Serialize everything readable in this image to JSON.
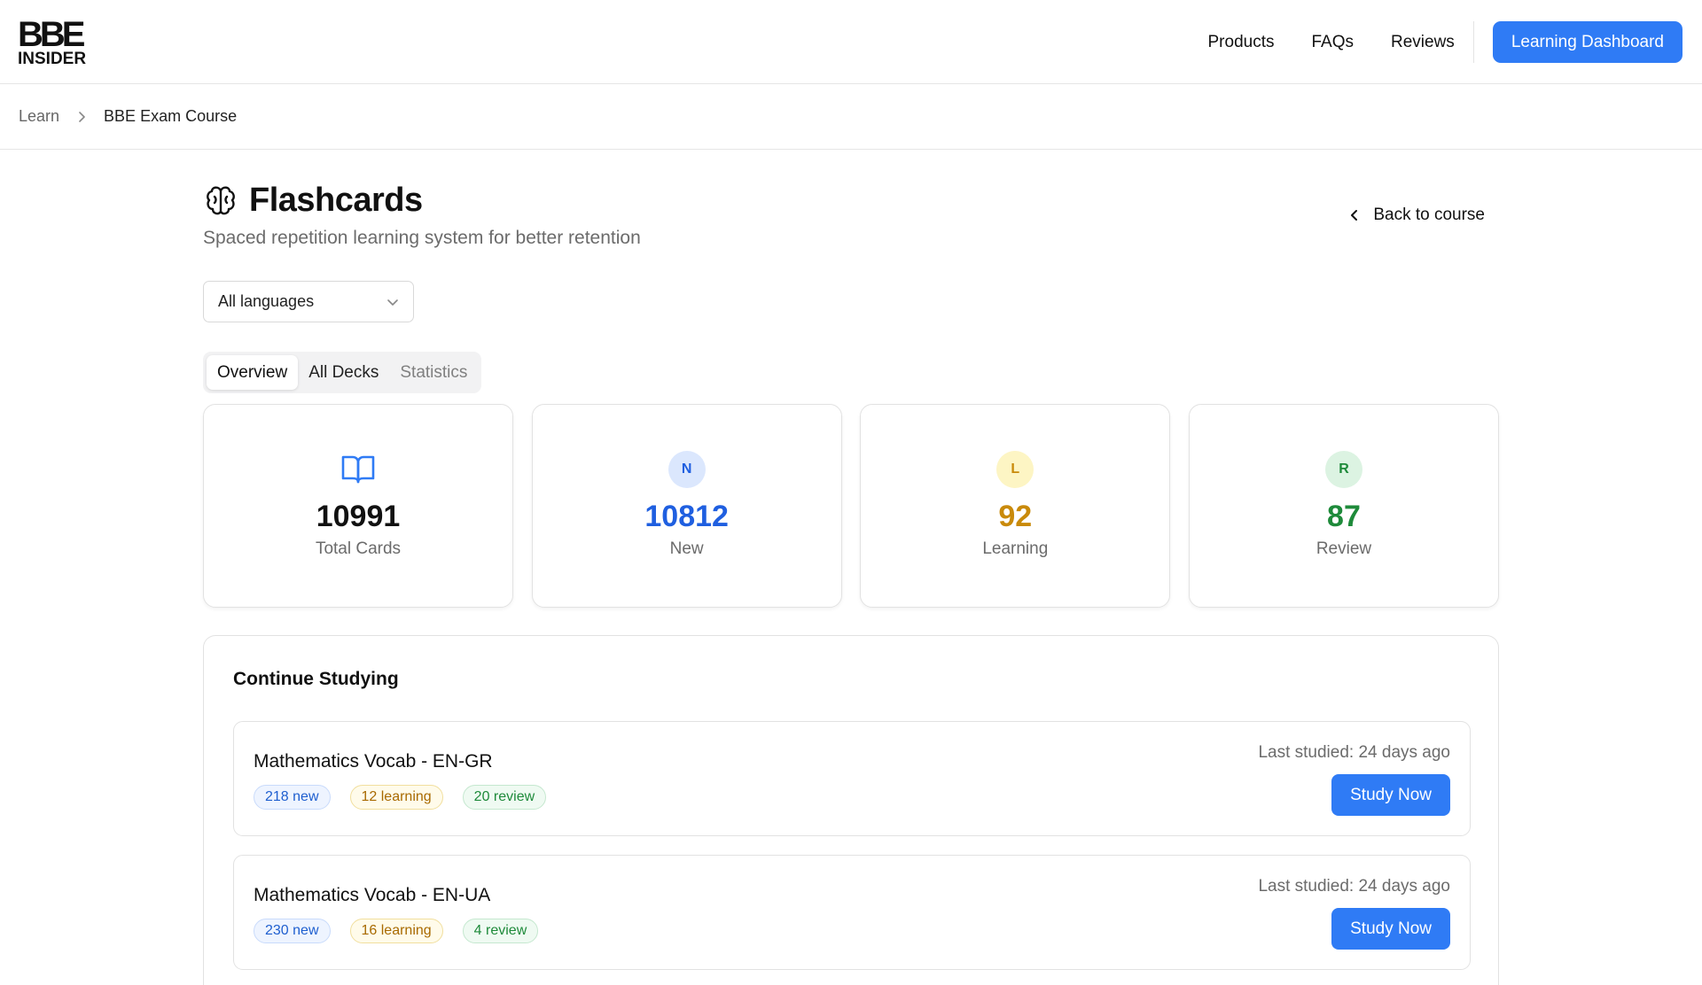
{
  "header": {
    "logo_mark": "BBE",
    "logo_sub": "INSIDER",
    "nav": [
      "Products",
      "FAQs",
      "Reviews"
    ],
    "cta_label": "Learning Dashboard"
  },
  "breadcrumb": {
    "items": [
      "Learn",
      "BBE Exam Course"
    ]
  },
  "page": {
    "title": "Flashcards",
    "subtitle": "Spaced repetition learning system for better retention",
    "back_label": "Back to course",
    "language_select": "All languages"
  },
  "tabs": [
    {
      "label": "Overview",
      "state": "active"
    },
    {
      "label": "All Decks",
      "state": "normal"
    },
    {
      "label": "Statistics",
      "state": "muted"
    }
  ],
  "stats": [
    {
      "badge": "",
      "icon": "book-open-icon",
      "value": "10991",
      "label": "Total Cards",
      "color": "#111111"
    },
    {
      "badge": "N",
      "value": "10812",
      "label": "New",
      "color": "#1f5fe0",
      "badge_bg": "#dbe7fd"
    },
    {
      "badge": "L",
      "value": "92",
      "label": "Learning",
      "color": "#c98a0a",
      "badge_bg": "#fdf5c4"
    },
    {
      "badge": "R",
      "value": "87",
      "label": "Review",
      "color": "#1e8a3a",
      "badge_bg": "#dcf3e2"
    }
  ],
  "continue": {
    "title": "Continue Studying",
    "decks": [
      {
        "name": "Mathematics Vocab - EN-GR",
        "new": "218 new",
        "learning": "12 learning",
        "review": "20 review",
        "last": "Last studied: 24 days ago",
        "action": "Study Now"
      },
      {
        "name": "Mathematics Vocab - EN-UA",
        "new": "230 new",
        "learning": "16 learning",
        "review": "4 review",
        "last": "Last studied: 24 days ago",
        "action": "Study Now"
      }
    ]
  },
  "colors": {
    "accent": "#2f7bf5",
    "border": "#e2e2e2",
    "muted_text": "#6b6b6b"
  }
}
